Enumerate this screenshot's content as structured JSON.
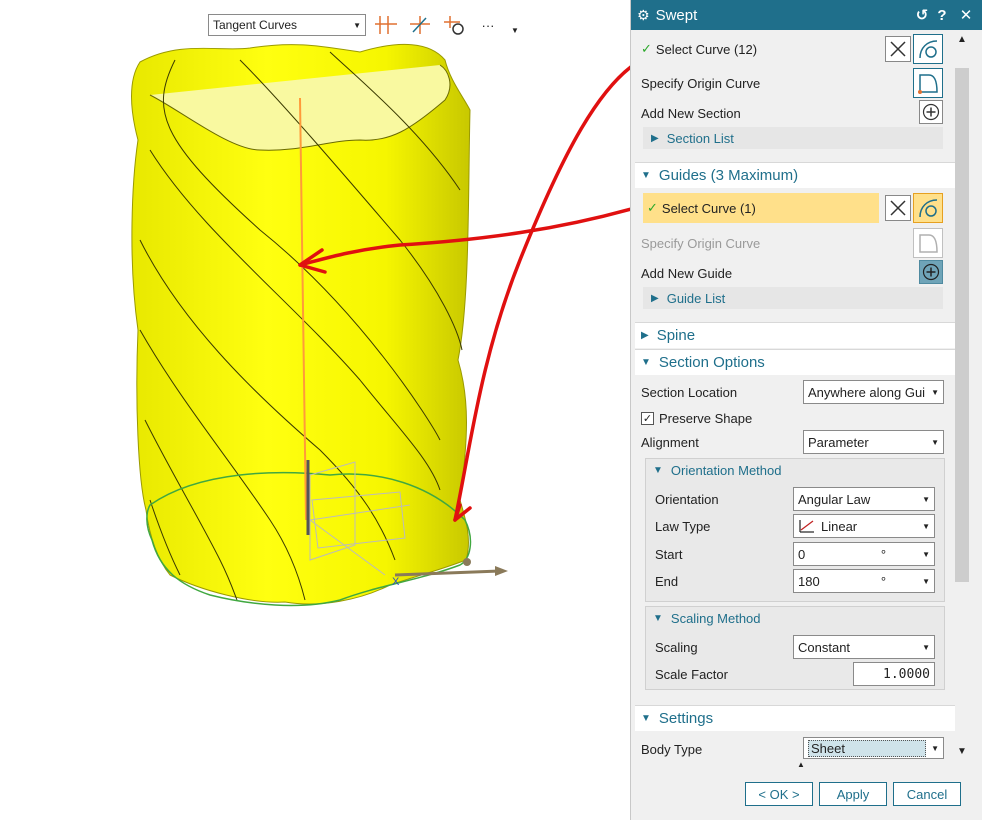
{
  "viewport": {
    "filter": {
      "value": "Tangent Curves"
    },
    "toolbar_icons": [
      "curve-rule-icon",
      "curve-intersect-icon",
      "curve-snap-icon",
      "more-icon",
      "overflow-icon"
    ],
    "more_label": "···"
  },
  "colors": {
    "accent": "#1f6f8b",
    "highlight": "#ffe08a",
    "surface": "#ffff00",
    "markup": "#e01010"
  },
  "dialog": {
    "title": "Swept",
    "titlebar_icons": {
      "reset": "↺",
      "help": "?",
      "close": "✕"
    },
    "sections_group": {
      "select_curve": "Select Curve (12)",
      "origin_curve": "Specify Origin Curve",
      "add_new": "Add New Section",
      "list": "Section List"
    },
    "guides": {
      "header": "Guides (3 Maximum)",
      "select_curve": "Select Curve (1)",
      "origin_curve": "Specify Origin Curve",
      "add_new": "Add New Guide",
      "list": "Guide List"
    },
    "spine": {
      "header": "Spine"
    },
    "section_options": {
      "header": "Section Options",
      "section_location_label": "Section Location",
      "section_location_value": "Anywhere along Gui",
      "preserve_shape_label": "Preserve Shape",
      "preserve_shape_checked": true,
      "alignment_label": "Alignment",
      "alignment_value": "Parameter",
      "orientation_method": {
        "header": "Orientation Method",
        "orientation_label": "Orientation",
        "orientation_value": "Angular Law",
        "law_type_label": "Law Type",
        "law_type_value": "Linear",
        "start_label": "Start",
        "start_value": "0",
        "start_unit": "°",
        "end_label": "End",
        "end_value": "180",
        "end_unit": "°"
      },
      "scaling_method": {
        "header": "Scaling Method",
        "scaling_label": "Scaling",
        "scaling_value": "Constant",
        "scale_factor_label": "Scale Factor",
        "scale_factor_value": "1.0000"
      }
    },
    "settings": {
      "header": "Settings",
      "body_type_label": "Body Type",
      "body_type_value": "Sheet"
    },
    "buttons": {
      "ok": "< OK >",
      "apply": "Apply",
      "cancel": "Cancel"
    }
  }
}
